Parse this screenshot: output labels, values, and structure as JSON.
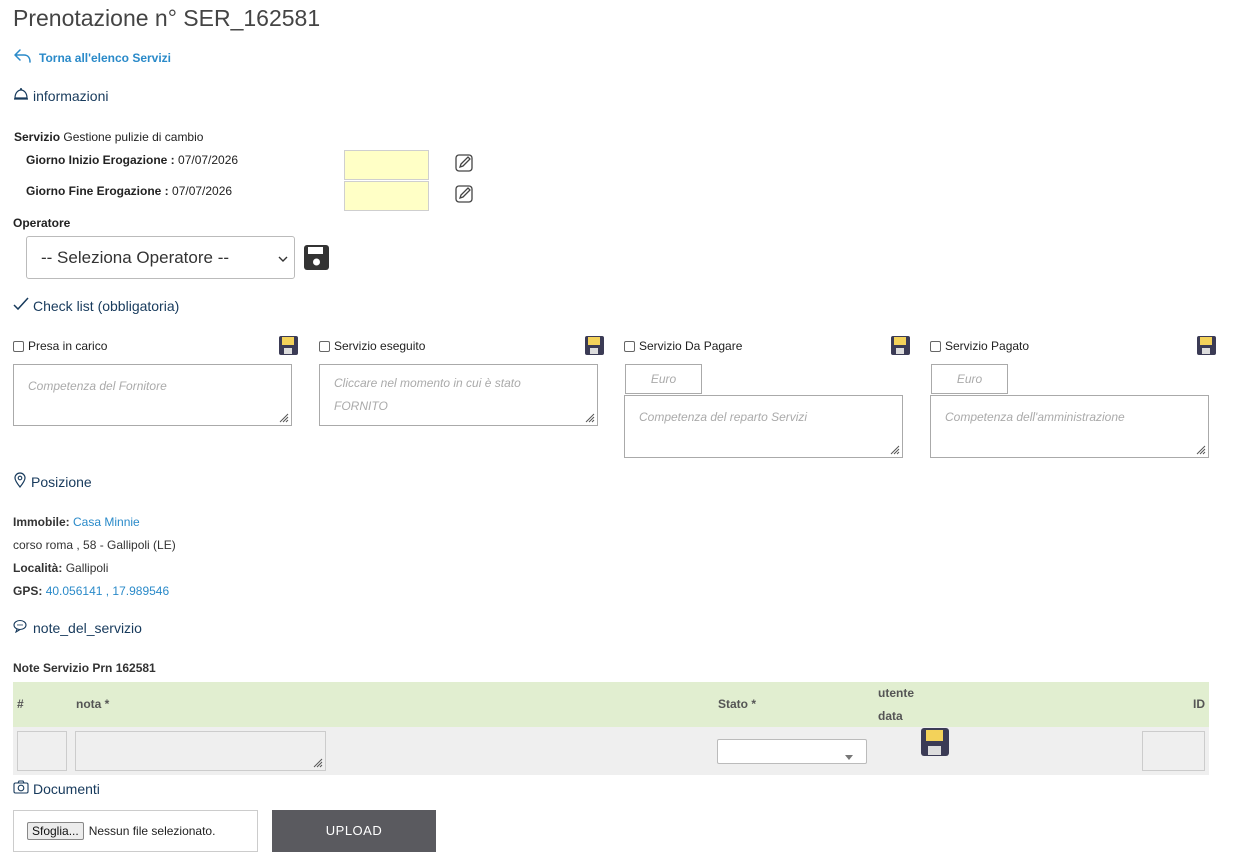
{
  "page_title": "Prenotazione n° SER_162581",
  "back_link": "Torna all'elenco Servizi",
  "info": {
    "section_title": "informazioni",
    "servizio_label": "Servizio",
    "servizio_value": "Gestione pulizie di cambio",
    "inizio_label": "Giorno Inizio Erogazione :",
    "inizio_value": "07/07/2026",
    "fine_label": "Giorno Fine Erogazione :",
    "fine_value": "07/07/2026",
    "operatore_label": "Operatore",
    "operatore_selected": "-- Seleziona Operatore --"
  },
  "checklist": {
    "section_title": "Check list (obbligatoria)",
    "items": [
      {
        "label": "Presa in carico",
        "placeholder": "Competenza del Fornitore"
      },
      {
        "label": "Servizio eseguito",
        "placeholder": "Cliccare nel momento in cui è stato FORNITO"
      },
      {
        "label": "Servizio Da Pagare",
        "euro": "Euro",
        "placeholder": "Competenza del reparto Servizi"
      },
      {
        "label": "Servizio Pagato",
        "euro": "Euro",
        "placeholder": "Competenza dell'amministrazione"
      }
    ]
  },
  "posizione": {
    "section_title": "Posizione",
    "immobile_label": "Immobile:",
    "immobile_value": "Casa Minnie",
    "address": "corso roma , 58 - Gallipoli (LE)",
    "localita_label": "Località:",
    "localita_value": "Gallipoli",
    "gps_label": "GPS:",
    "gps_value": "40.056141 , 17.989546"
  },
  "note": {
    "section_title": "note_del_servizio",
    "table_title": "Note Servizio Prn 162581",
    "col_hash": "#",
    "col_nota": "nota *",
    "col_stato": "Stato *",
    "col_utente": "utente",
    "col_data": "data",
    "col_id": "ID"
  },
  "documenti": {
    "section_title": "Documenti",
    "file_button": "Sfoglia...",
    "file_status": "Nessun file selezionato.",
    "upload_label": "UPLOAD"
  },
  "colors": {
    "accent_link": "#2a8ac9",
    "section_heading": "#173a5c",
    "date_field_bg": "#ffffc6",
    "table_header_bg": "#e1eed0",
    "upload_bg": "#5a5a5f"
  }
}
